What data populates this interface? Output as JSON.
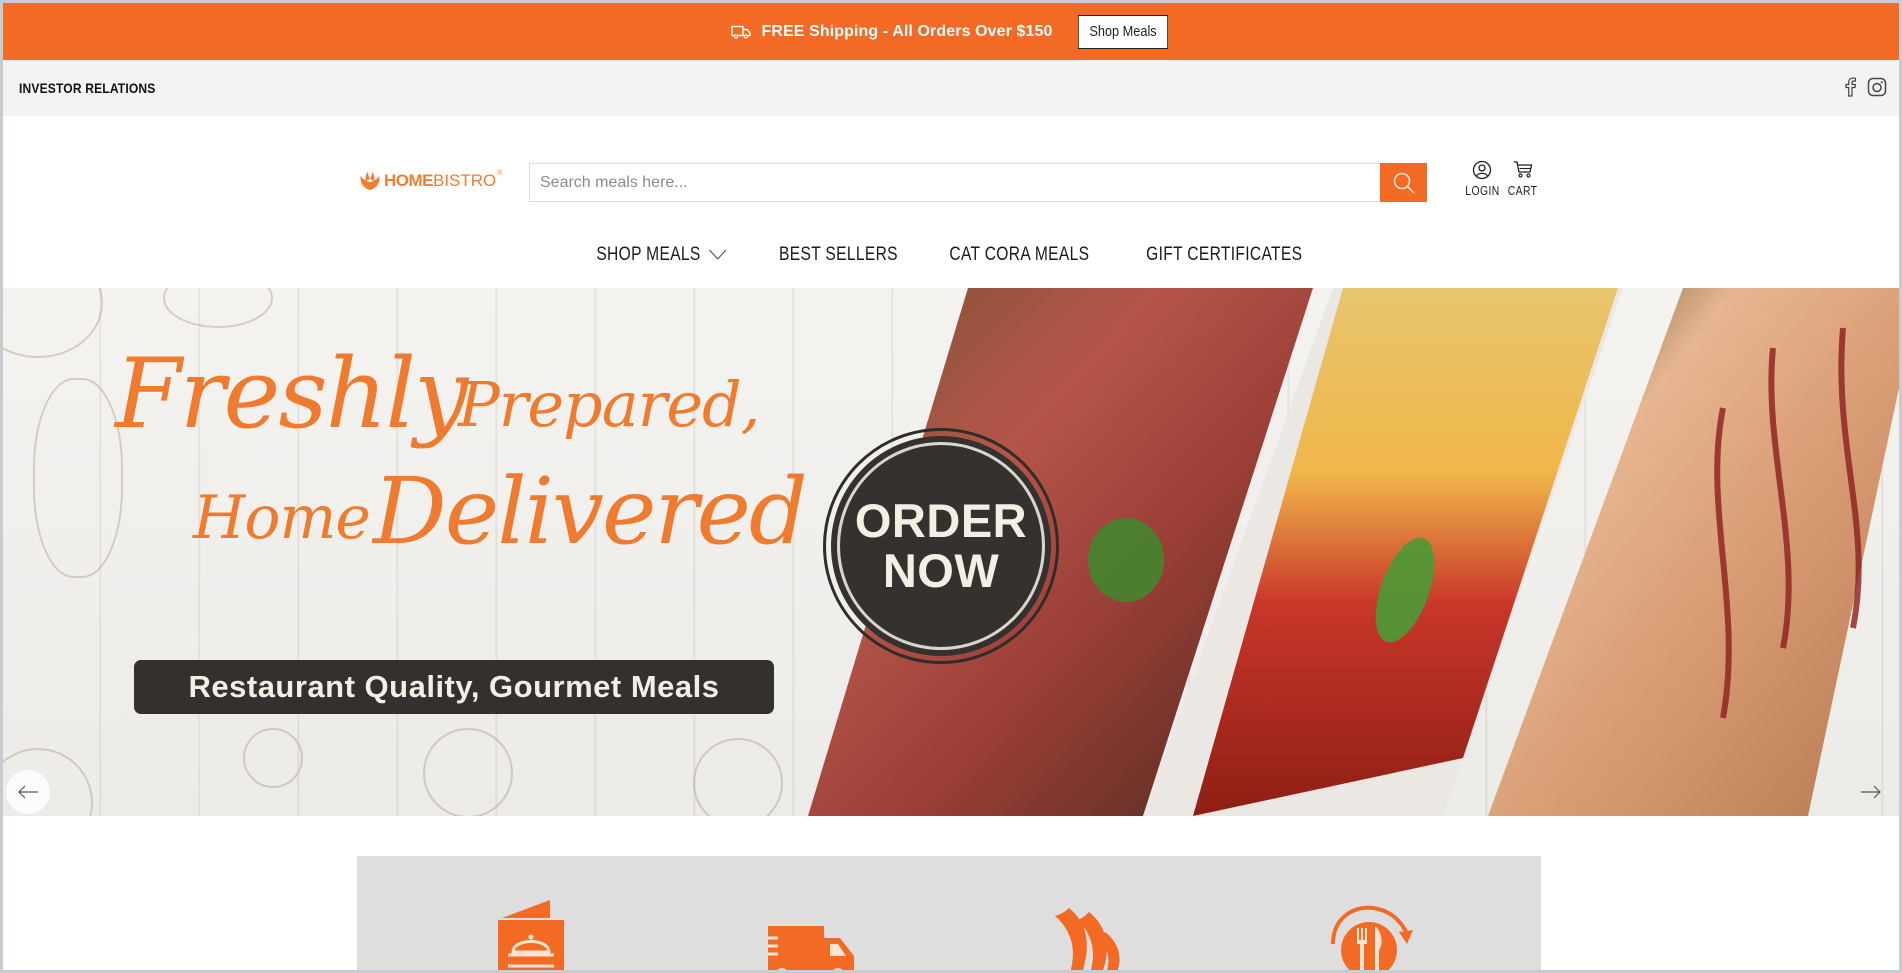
{
  "announcement": {
    "icon": "truck-icon",
    "message": "FREE Shipping - All Orders Over $150",
    "button_label": "Shop Meals"
  },
  "utility_bar": {
    "investor_relations": "INVESTOR RELATIONS",
    "social": [
      {
        "name": "facebook",
        "icon": "facebook-icon"
      },
      {
        "name": "instagram",
        "icon": "instagram-icon"
      }
    ]
  },
  "header": {
    "logo": {
      "part1": "HOME",
      "part2": "BISTRO",
      "reg": "®"
    },
    "search": {
      "placeholder": "Search meals here...",
      "value": ""
    },
    "login_label": "LOGIN",
    "cart_label": "CART"
  },
  "nav": {
    "items": [
      {
        "label": "SHOP MEALS",
        "has_dropdown": true
      },
      {
        "label": "BEST SELLERS"
      },
      {
        "label": "CAT CORA MEALS"
      },
      {
        "label": "GIFT CERTIFICATES"
      }
    ]
  },
  "hero": {
    "headline_line1_a": "Freshly",
    "headline_line1_b": "Prepared,",
    "headline_line2_a": "Home",
    "headline_line2_b": "Delivered",
    "tagline": "Restaurant Quality, Gourmet Meals",
    "cta_line1": "ORDER",
    "cta_line2": "NOW",
    "prev_icon": "arrow-left-icon",
    "next_icon": "arrow-right-icon"
  },
  "features": {
    "icons": [
      "menu-cloche-icon",
      "delivery-truck-icon",
      "flame-icon",
      "plate-cutlery-cycle-icon"
    ]
  },
  "colors": {
    "brand_orange": "#f26a24",
    "logo_orange": "#ef7d32",
    "dark_badge": "#35312e",
    "utility_bg": "#f3f3f3",
    "feature_bg": "#dedede"
  }
}
